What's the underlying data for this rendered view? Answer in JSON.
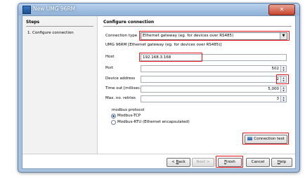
{
  "window": {
    "title": "New UMG 96RM",
    "close_glyph": "✕"
  },
  "steps": {
    "title": "Steps",
    "items": [
      "1.   Configure connection"
    ]
  },
  "panel": {
    "title": "Configure connection",
    "connection_type": {
      "label": "Connection type",
      "value": "Ethernet gateway (eg. for devices over RS485)"
    },
    "device_subtitle": "UMG 96RM [Ethernet gateway (eg. for devices over RS485)]",
    "fields": {
      "host": {
        "label": "Host",
        "value": "192.168.3.168"
      },
      "port": {
        "label": "Port",
        "value": "502"
      },
      "device_address": {
        "label": "Device address",
        "value": "2"
      },
      "timeout": {
        "label": "Time out [millisec.]",
        "value": "5,000"
      },
      "retries": {
        "label": "Max. no. retries",
        "value": "3"
      }
    },
    "modbus": {
      "title": "modbus protocol",
      "options": [
        "Modbus-TCP",
        "Modbus-RTU (Ethernet encapsulated)"
      ],
      "selected": 0
    },
    "connection_test_label": "Connection test"
  },
  "footer": {
    "back": {
      "pre": "< ",
      "u": "B",
      "post": "ack"
    },
    "next": "Next >",
    "finish": {
      "u": "F",
      "post": "inish"
    },
    "cancel": "Cancel",
    "help": {
      "u": "H",
      "post": "elp"
    }
  },
  "colors": {
    "highlight": "#e8141c",
    "titlebar": "#8fb0d8"
  }
}
